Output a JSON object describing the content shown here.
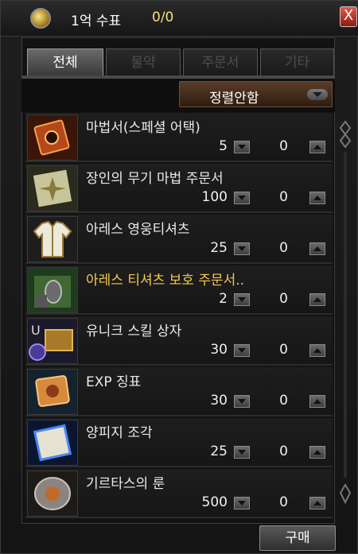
{
  "window": {
    "title": "1억 수표",
    "count": "0/0",
    "close_label": "X"
  },
  "tabs": [
    {
      "label": "전체",
      "active": true
    },
    {
      "label": "물약",
      "active": false
    },
    {
      "label": "주문서",
      "active": false
    },
    {
      "label": "기타",
      "active": false
    }
  ],
  "sort": {
    "selected": "정렬안함"
  },
  "items": [
    {
      "name": "마법서(스페셜 어택)",
      "price": "5",
      "qty": "0",
      "icon": "spellbook-icon",
      "highlight": false
    },
    {
      "name": "장인의 무기 마법 주문서",
      "price": "100",
      "qty": "0",
      "icon": "scroll-icon",
      "highlight": false
    },
    {
      "name": "아레스 영웅티셔츠",
      "price": "25",
      "qty": "0",
      "icon": "tshirt-icon",
      "highlight": false
    },
    {
      "name": "아레스 티셔츠 보호 주문서..",
      "price": "2",
      "qty": "0",
      "icon": "protection-scroll-icon",
      "highlight": true
    },
    {
      "name": "유니크 스킬 상자",
      "price": "30",
      "qty": "0",
      "icon": "unique-box-icon",
      "highlight": false
    },
    {
      "name": "EXP 징표",
      "price": "30",
      "qty": "0",
      "icon": "exp-token-icon",
      "highlight": false
    },
    {
      "name": "양피지 조각",
      "price": "25",
      "qty": "0",
      "icon": "parchment-icon",
      "highlight": false
    },
    {
      "name": "기르타스의 룬",
      "price": "500",
      "qty": "0",
      "icon": "rune-icon",
      "highlight": false
    }
  ],
  "buy_button": {
    "label": "구매"
  }
}
